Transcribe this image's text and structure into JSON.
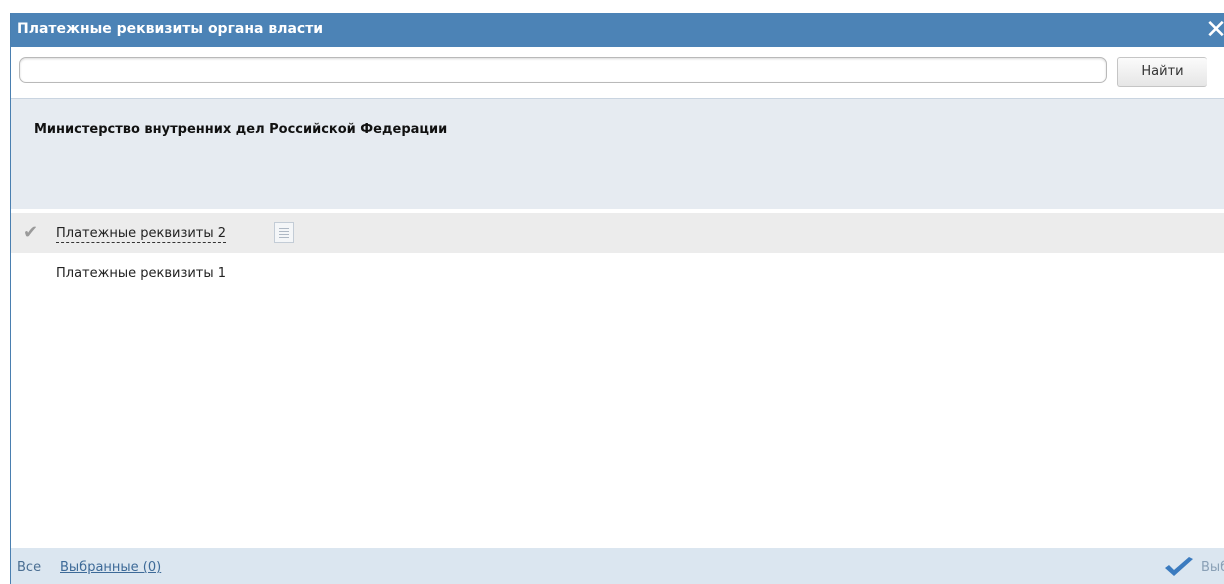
{
  "dialog": {
    "title": "Платежные реквизиты органа власти",
    "close_glyph": "✕"
  },
  "search": {
    "value": "",
    "placeholder": "",
    "button_label": "Найти"
  },
  "organization": {
    "name": "Министерство внутренних дел Российской Федерации"
  },
  "list": {
    "items": [
      {
        "label": "Платежные реквизиты 2",
        "selected": true,
        "icon": "document-icon"
      },
      {
        "label": "Платежные реквизиты 1",
        "selected": false
      }
    ]
  },
  "footer": {
    "all_label": "Все",
    "selected_label": "Выбранные (0)",
    "select_button_label": "Выбрать"
  },
  "colors": {
    "titlebar": "#4c83b6",
    "org_panel": "#e6ebf1",
    "footer": "#dbe6f0",
    "selected_row": "#ececec",
    "select_check": "#3b7bbf"
  }
}
